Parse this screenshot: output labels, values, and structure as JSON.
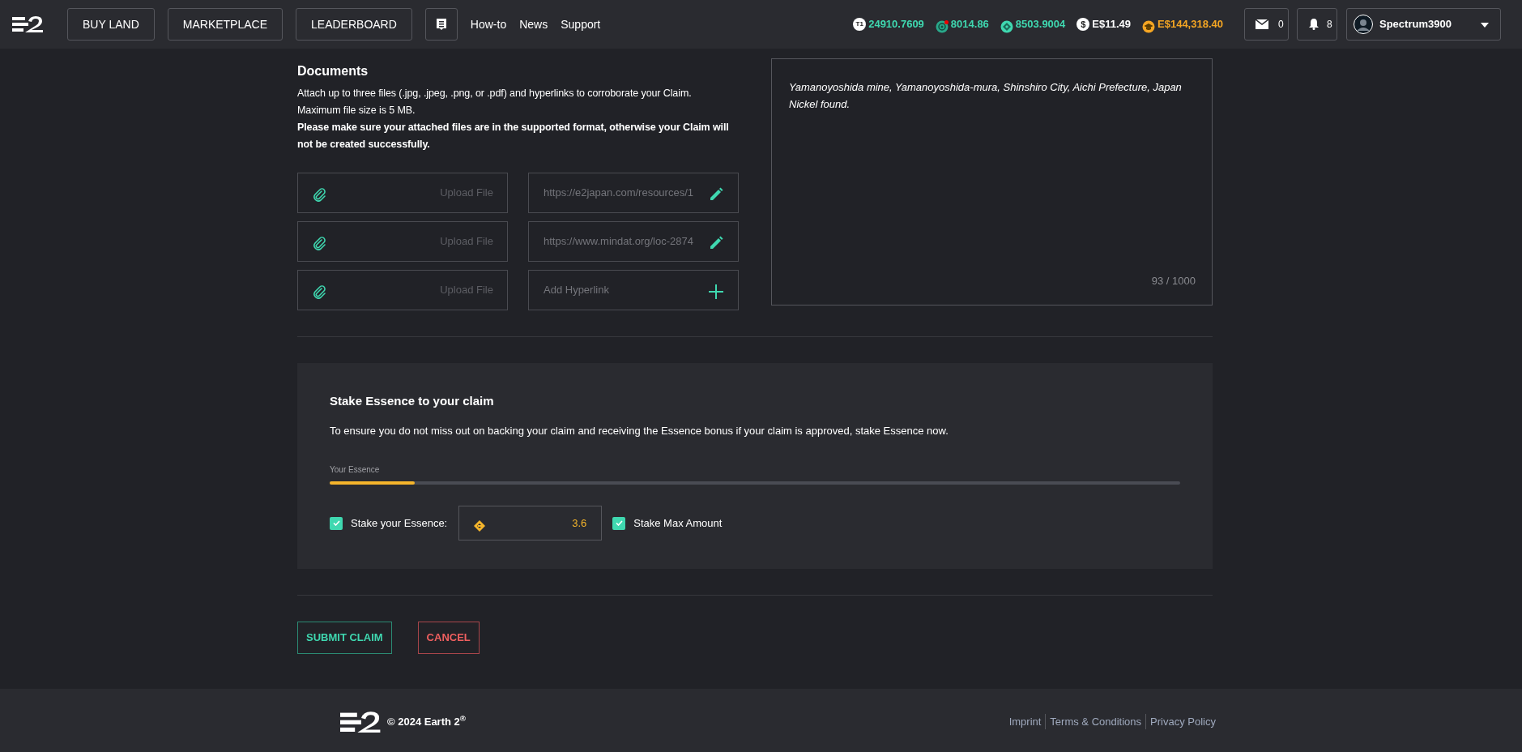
{
  "navbar": {
    "buttons": [
      "BUY LAND",
      "MARKETPLACE",
      "LEADERBOARD"
    ],
    "links": [
      "How-to",
      "News",
      "Support"
    ],
    "balances": [
      {
        "kind": "tier",
        "badge": "T1",
        "value": "24910.7609",
        "color": "#3fd8b0"
      },
      {
        "kind": "target",
        "value": "8014.86",
        "color": "#3fd8b0"
      },
      {
        "kind": "diamond",
        "value": "8503.9004",
        "color": "#3fd8b0"
      },
      {
        "kind": "dollar",
        "badge": "$",
        "value": "E$11.49",
        "color": "#ffffff"
      },
      {
        "kind": "cap",
        "value": "E$144,318.40",
        "color": "#f5a623"
      }
    ],
    "messages": "0",
    "notifications": "8",
    "user": "Spectrum3900"
  },
  "documents": {
    "title": "Documents",
    "notes": [
      {
        "text": "Attach up to three files (.jpg, .jpeg, .png, or .pdf) and hyperlinks to corroborate your Claim.",
        "bold": false
      },
      {
        "text": "Maximum file size is 5 MB.",
        "bold": false
      },
      {
        "text": "Please make sure your attached files are in the supported format, otherwise your Claim will not be created successfully.",
        "bold": true
      }
    ],
    "uploads": [
      {
        "placeholder": "Upload File"
      },
      {
        "placeholder": "Upload File"
      },
      {
        "placeholder": "Upload File"
      }
    ],
    "hyperlinks": [
      {
        "kind": "edit",
        "value": "https://e2japan.com/resources/1"
      },
      {
        "kind": "edit",
        "value": "https://www.mindat.org/loc-2874"
      },
      {
        "kind": "add",
        "placeholder": "Add Hyperlink"
      }
    ],
    "description": {
      "value": "Yamanoyoshida mine, Yamanoyoshida-mura, Shinshiro City, Aichi Prefecture, Japan\nNickel found.",
      "counter": "93 / 1000"
    }
  },
  "stake": {
    "title": "Stake Essence to your claim",
    "text": "To ensure you do not miss out on backing your claim and receiving the Essence bonus if your claim is approved, stake Essence now.",
    "essence_label": "Your Essence",
    "level": 0.1,
    "stake_checkbox": {
      "label": "Stake your Essence:",
      "checked": true
    },
    "amount": "3.6",
    "max_checkbox": {
      "label": "Stake Max Amount",
      "checked": true
    }
  },
  "actions": {
    "submit": "SUBMIT CLAIM",
    "cancel": "CANCEL"
  },
  "footer": {
    "copyright": "© 2024 Earth 2$^{®}$",
    "links": [
      "Imprint",
      "Terms & Conditions",
      "Privacy Policy"
    ]
  }
}
